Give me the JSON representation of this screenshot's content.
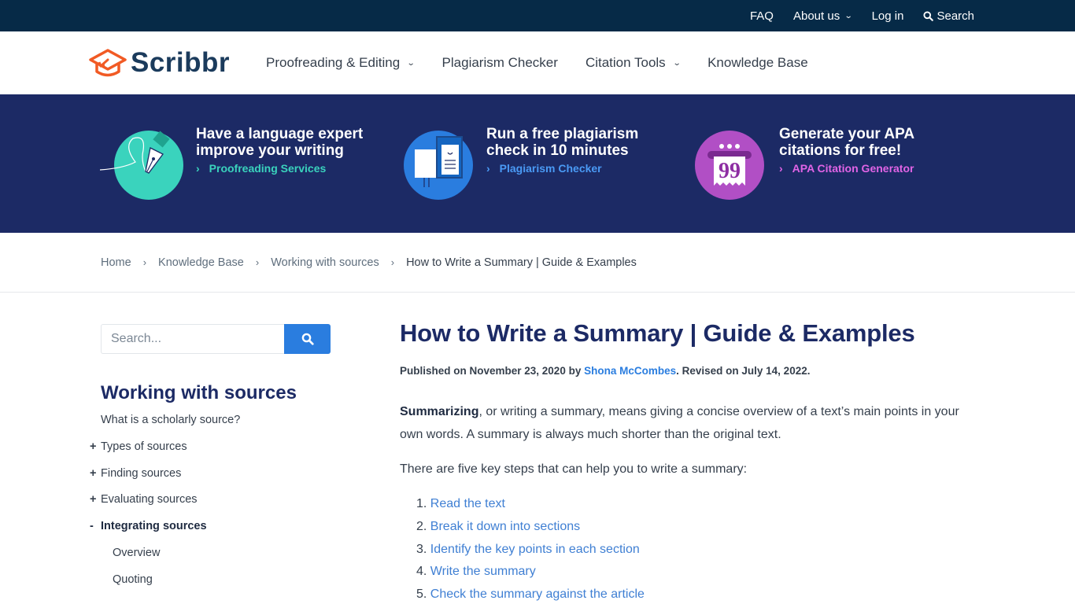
{
  "topbar": {
    "items": [
      {
        "label": "FAQ"
      },
      {
        "label": "About us",
        "has_dropdown": true
      },
      {
        "label": "Log in"
      },
      {
        "label": "Search",
        "icon": "search-icon"
      }
    ]
  },
  "brand": {
    "name": "Scribbr",
    "logo_color": "#f15a24",
    "text_color": "#1b3b5c"
  },
  "mainnav": {
    "items": [
      {
        "label": "Proofreading & Editing",
        "has_dropdown": true
      },
      {
        "label": "Plagiarism Checker",
        "has_dropdown": false
      },
      {
        "label": "Citation Tools",
        "has_dropdown": true
      },
      {
        "label": "Knowledge Base",
        "has_dropdown": false
      }
    ]
  },
  "promo": {
    "cards": [
      {
        "title_line1": "Have a language expert",
        "title_line2": "improve your writing",
        "link": "Proofreading Services",
        "link_color": "#3ad3bd",
        "icon": "fountain-pen-icon",
        "icon_bg": "#3ad3bd"
      },
      {
        "title_line1": "Run a free plagiarism",
        "title_line2": "check in 10 minutes",
        "link": "Plagiarism Checker",
        "link_color": "#4a9af5",
        "icon": "documents-icon",
        "icon_bg": "#2a7ddf"
      },
      {
        "title_line1": "Generate your APA",
        "title_line2": "citations for free!",
        "link": "APA Citation Generator",
        "link_color": "#e164e6",
        "icon": "citation-machine-icon",
        "icon_bg": "#b14fc5"
      }
    ]
  },
  "breadcrumb": {
    "items": [
      "Home",
      "Knowledge Base",
      "Working with sources"
    ],
    "current": "How to Write a Summary | Guide & Examples",
    "separator": "›"
  },
  "sidebar": {
    "search_placeholder": "Search...",
    "title": "Working with sources",
    "items": [
      {
        "label": "What is a scholarly source?",
        "toggle": ""
      },
      {
        "label": "Types of sources",
        "toggle": "+"
      },
      {
        "label": "Finding sources",
        "toggle": "+"
      },
      {
        "label": "Evaluating sources",
        "toggle": "+"
      },
      {
        "label": "Integrating sources",
        "toggle": "-",
        "active": true
      },
      {
        "label": "Overview",
        "sub": true
      },
      {
        "label": "Quoting",
        "sub": true
      }
    ]
  },
  "article": {
    "title": "How to Write a Summary | Guide & Examples",
    "meta_prefix": "Published on November 23, 2020 by ",
    "author": "Shona McCombes",
    "meta_suffix": ". Revised on July 14, 2022.",
    "intro_bold": "Summarizing",
    "intro_rest": ", or writing a summary, means giving a concise overview of a text’s main points in your own words. A summary is always much shorter than the original text.",
    "steps_intro": "There are five key steps that can help you to write a summary:",
    "steps": [
      {
        "num": "1.",
        "label": "Read the text"
      },
      {
        "num": "2.",
        "label": "Break it down into sections"
      },
      {
        "num": "3.",
        "label": "Identify the key points in each section"
      },
      {
        "num": "4.",
        "label": "Write the summary"
      },
      {
        "num": "5.",
        "label": "Check the summary against the article"
      }
    ]
  }
}
